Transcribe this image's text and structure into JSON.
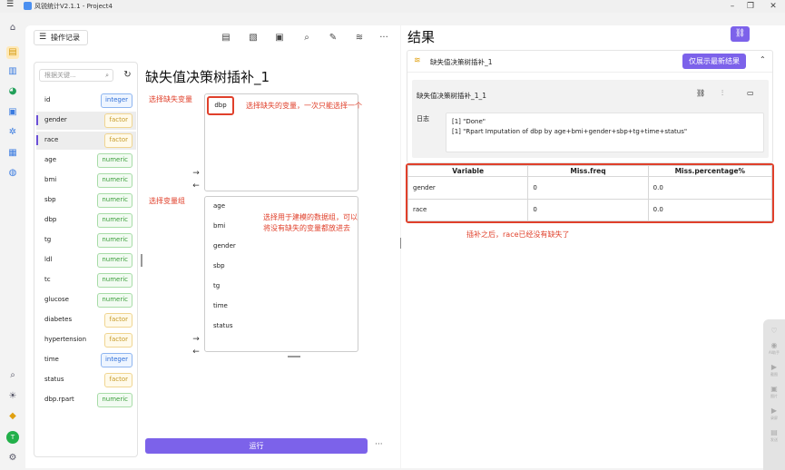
{
  "window": {
    "title": "风锐统计V2.1.1 - Project4"
  },
  "toolbar": {
    "op_record": "操作记录"
  },
  "search": {
    "placeholder": "根据关键..."
  },
  "variables": [
    {
      "name": "id",
      "type": "integer"
    },
    {
      "name": "gender",
      "type": "factor"
    },
    {
      "name": "race",
      "type": "factor"
    },
    {
      "name": "age",
      "type": "numeric"
    },
    {
      "name": "bmi",
      "type": "numeric"
    },
    {
      "name": "sbp",
      "type": "numeric"
    },
    {
      "name": "dbp",
      "type": "numeric"
    },
    {
      "name": "tg",
      "type": "numeric"
    },
    {
      "name": "ldl",
      "type": "numeric"
    },
    {
      "name": "tc",
      "type": "numeric"
    },
    {
      "name": "glucose",
      "type": "numeric"
    },
    {
      "name": "diabetes",
      "type": "factor"
    },
    {
      "name": "hypertension",
      "type": "factor"
    },
    {
      "name": "time",
      "type": "integer"
    },
    {
      "name": "status",
      "type": "factor"
    },
    {
      "name": "dbp.rpart",
      "type": "numeric"
    }
  ],
  "center": {
    "heading": "缺失值决策树插补_1",
    "missing_label": "选择缺失变量",
    "missing_var": "dbp",
    "missing_hint": "选择缺失的变量，一次只能选择一个",
    "group_label": "选择变量组",
    "group_hint_1": "选择用于建模的数据组，可以",
    "group_hint_2": "将没有缺失的变量都放进去",
    "group_items": [
      "age",
      "bmi",
      "gender",
      "sbp",
      "tg",
      "time",
      "status"
    ],
    "run_label": "运行",
    "more": "···"
  },
  "result": {
    "title": "结果",
    "card_title": "缺失值决策树插补_1",
    "show_latest": "仅展示最新结果",
    "inner_title": "缺失值决策树插补_1_1",
    "log_label": "日志",
    "log_lines": [
      "[1] \"Done\"",
      "[1] \"Rpart Imputation of dbp by age+bmi+gender+sbp+tg+time+status\""
    ],
    "table": {
      "headers": [
        "Variable",
        "Miss.freq",
        "Miss.percentage%"
      ],
      "rows": [
        [
          "gender",
          "0",
          "0.0"
        ],
        [
          "race",
          "0",
          "0.0"
        ]
      ]
    },
    "note": "插补之后，race已经没有缺失了"
  },
  "floatbar": [
    "AI助手",
    "截图",
    "图片",
    "录屏",
    "发送"
  ],
  "colors": {
    "accent": "#7c62ea",
    "annotation": "#e0402b"
  }
}
